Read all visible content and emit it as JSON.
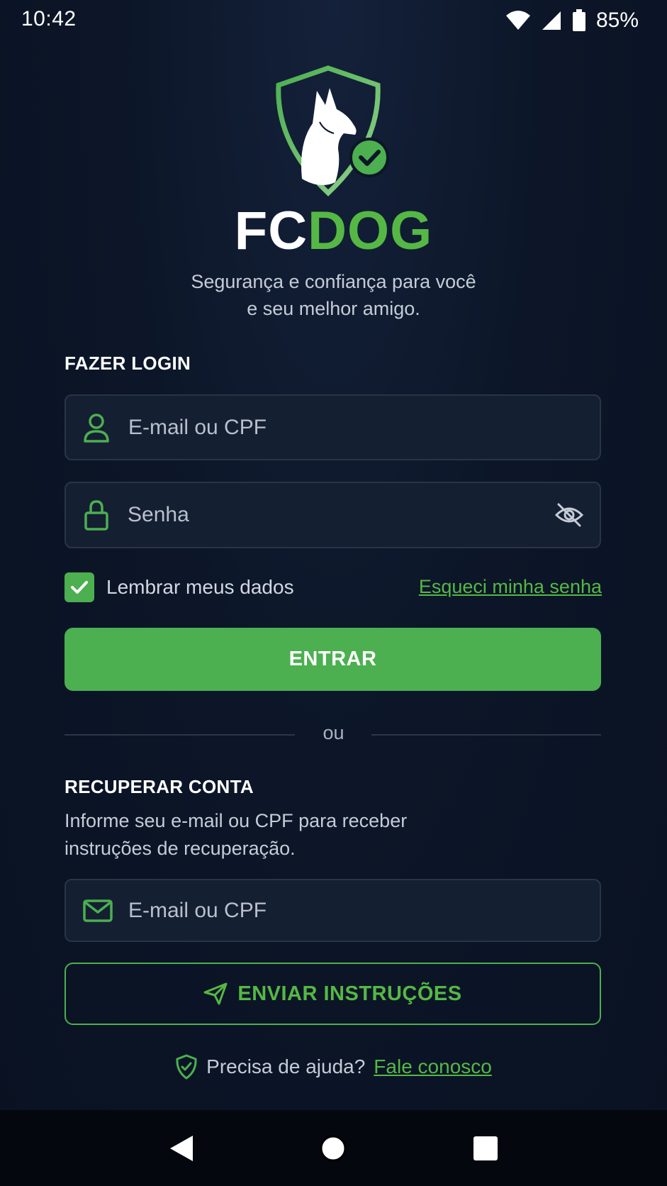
{
  "status_bar": {
    "time": "10:42",
    "battery": "85%"
  },
  "brand": {
    "part1": "FC",
    "part2": "DOG",
    "logo_icon": "shield-dog-check-icon"
  },
  "tagline": {
    "line1": "Segurança e confiança para você",
    "line2": "e seu melhor amigo."
  },
  "login": {
    "title": "FAZER LOGIN",
    "email_placeholder": "E-mail ou CPF",
    "password_placeholder": "Senha",
    "remember_label": "Lembrar meus dados",
    "remember_checked": true,
    "forgot_link": "Esqueci minha senha",
    "submit_label": "ENTRAR"
  },
  "divider": {
    "label": "ou"
  },
  "recover": {
    "title": "RECUPERAR CONTA",
    "description_line1": "Informe seu e-mail ou CPF para receber",
    "description_line2": "instruções de recuperação.",
    "email_placeholder": "E-mail ou CPF",
    "submit_label": "ENVIAR INSTRUÇÕES"
  },
  "help": {
    "text": "Precisa de ajuda?",
    "link": "Fale conosco"
  },
  "colors": {
    "accent": "#4caf50",
    "background": "#0c1628",
    "field": "#151f32"
  }
}
